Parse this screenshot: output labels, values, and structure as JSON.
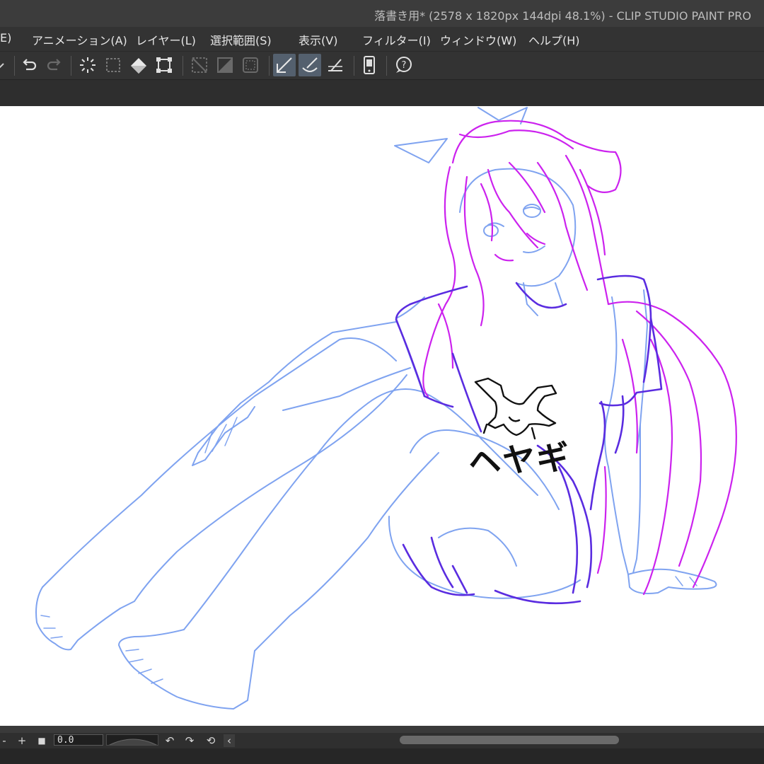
{
  "window": {
    "title": "落書き用* (2578 x 1820px 144dpi 48.1%)  - CLIP STUDIO PAINT PRO"
  },
  "menu": {
    "items": [
      {
        "id": "edit-partial",
        "label": "E)"
      },
      {
        "id": "animation",
        "label": "アニメーション(A)"
      },
      {
        "id": "layer",
        "label": "レイヤー(L)"
      },
      {
        "id": "selection",
        "label": "選択範囲(S)"
      },
      {
        "id": "view",
        "label": "表示(V)"
      },
      {
        "id": "filter",
        "label": "フィルター(I)"
      },
      {
        "id": "window",
        "label": "ウィンドウ(W)"
      },
      {
        "id": "help",
        "label": "ヘルプ(H)"
      }
    ]
  },
  "toolbar": {
    "icons": [
      "dropdown-arrow-icon",
      "undo-icon",
      "redo-icon",
      "loading-spinner-icon",
      "selection-dotted-icon",
      "fill-bucket-icon",
      "transform-icon",
      "clear-selection-icon",
      "invert-selection-icon",
      "selection-border-icon",
      "snap-ruler-icon",
      "snap-special-ruler-icon",
      "snap-grid-icon",
      "smartphone-icon",
      "help-bubble-icon"
    ],
    "active": [
      "snap-ruler-icon",
      "snap-special-ruler-icon"
    ]
  },
  "canvas": {
    "shirt_text": "ヘヤギ",
    "stroke_colors": {
      "sketch_blue": "#7fa3f0",
      "hair_magenta": "#cc22ee",
      "shirt_violet": "#5a2ce0",
      "ink_black": "#111111"
    }
  },
  "statusbar": {
    "zoom_out_label": "-",
    "zoom_in_label": "+",
    "stop_label": "■",
    "zoom_value": "0.0",
    "rotate_left_label": "↶",
    "rotate_right_label": "↷",
    "reset_label": "⟲",
    "scroll_left_label": "‹"
  },
  "colors": {
    "titlebar_bg": "#3c3c3c",
    "menubar_bg": "#333333",
    "active_button": "#54606e"
  }
}
